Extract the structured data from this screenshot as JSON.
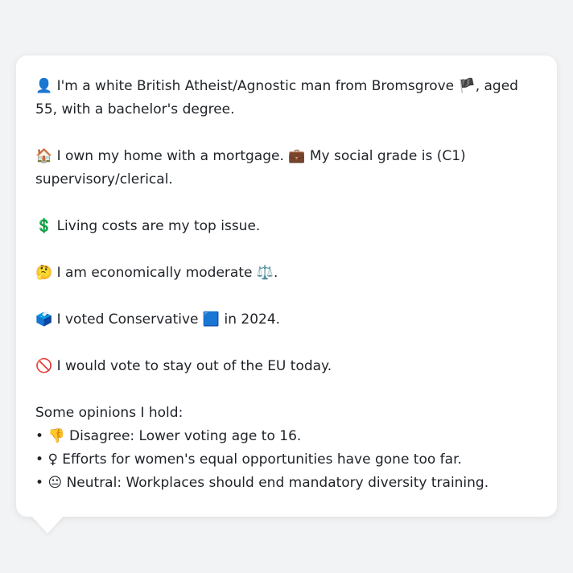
{
  "profile": {
    "intro": {
      "icon": "👤",
      "text1": "I'm a white British Atheist/Agnostic man from Bromsgrove",
      "flag": "🏴",
      "text2": ", aged 55, with a bachelor's degree."
    },
    "home": {
      "icon": "🏠",
      "text1": "I own my home with a mortgage.",
      "icon2": "💼",
      "text2": "My social grade is (C1) supervisory/clerical."
    },
    "issue": {
      "icon": "💲",
      "text": "Living costs are my top issue."
    },
    "economic": {
      "icon": "🤔",
      "text": "I am economically moderate",
      "icon2": "⚖️",
      "tail": "."
    },
    "vote": {
      "icon": "🗳️",
      "text": "I voted Conservative",
      "icon2": "🟦",
      "tail": "in 2024."
    },
    "eu": {
      "icon": "🚫",
      "text": "I would vote to stay out of the EU today."
    },
    "opinions": {
      "heading": "Some opinions I hold:",
      "bullet": "•",
      "items": [
        {
          "icon": "👎",
          "text": "Disagree: Lower voting age to 16."
        },
        {
          "icon": "♀",
          "text": "Efforts for women's equal opportunities have gone too far."
        },
        {
          "icon": "😐",
          "text": "Neutral: Workplaces should end mandatory diversity training."
        }
      ]
    }
  }
}
